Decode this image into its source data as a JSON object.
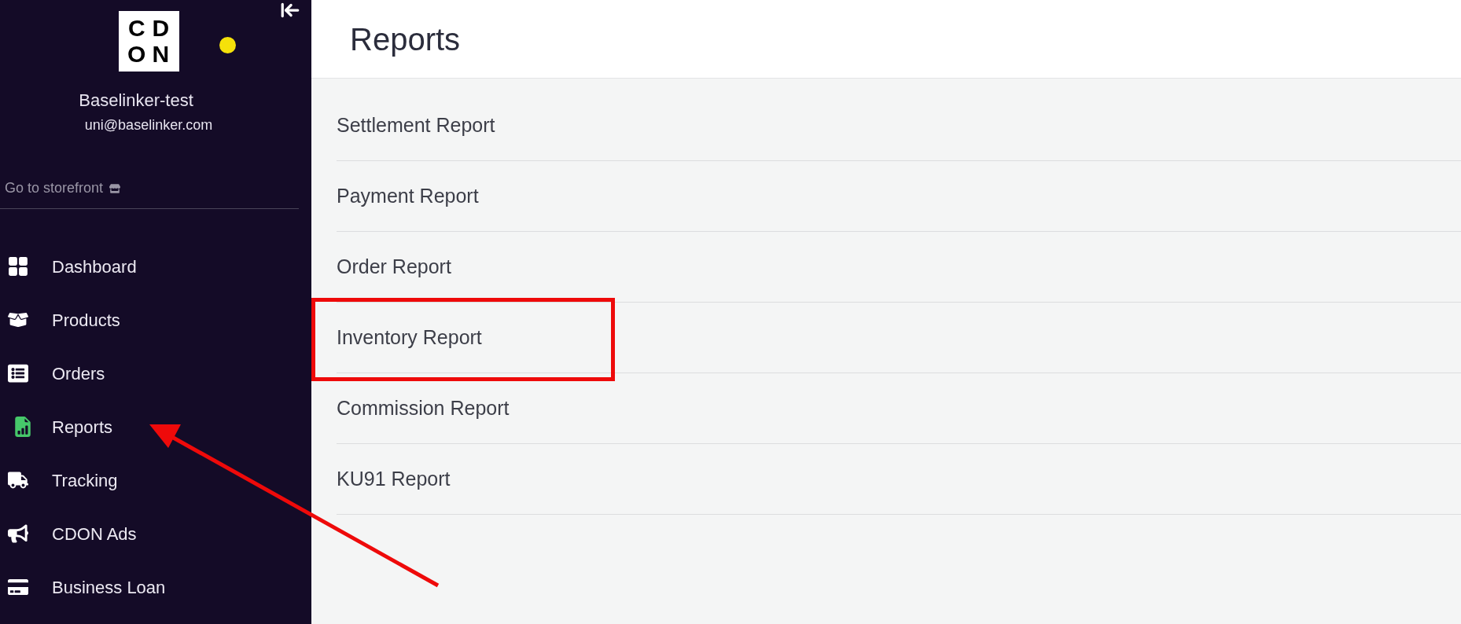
{
  "sidebar": {
    "logo_letters": [
      "C",
      "D",
      "O",
      "N"
    ],
    "status_dot": {
      "color": "#f5e10a"
    },
    "account_name": "Baselinker-test",
    "account_email": "uni@baselinker.com",
    "storefront_link": "Go to storefront",
    "items": [
      {
        "label": "Dashboard",
        "selected": false,
        "annotated": false
      },
      {
        "label": "Products",
        "selected": false,
        "annotated": false
      },
      {
        "label": "Orders",
        "selected": false,
        "annotated": false
      },
      {
        "label": "Reports",
        "selected": true,
        "annotated": true
      },
      {
        "label": "Tracking",
        "selected": false,
        "annotated": false
      },
      {
        "label": "CDON Ads",
        "selected": false,
        "annotated": false
      },
      {
        "label": "Business Loan",
        "selected": false,
        "annotated": false
      }
    ]
  },
  "page": {
    "title": "Reports",
    "reports": [
      {
        "label": "Settlement Report",
        "highlighted": false
      },
      {
        "label": "Payment Report",
        "highlighted": false
      },
      {
        "label": "Order Report",
        "highlighted": false
      },
      {
        "label": "Inventory Report",
        "highlighted": true
      },
      {
        "label": "Commission Report",
        "highlighted": false
      },
      {
        "label": "KU91 Report",
        "highlighted": false
      }
    ]
  }
}
